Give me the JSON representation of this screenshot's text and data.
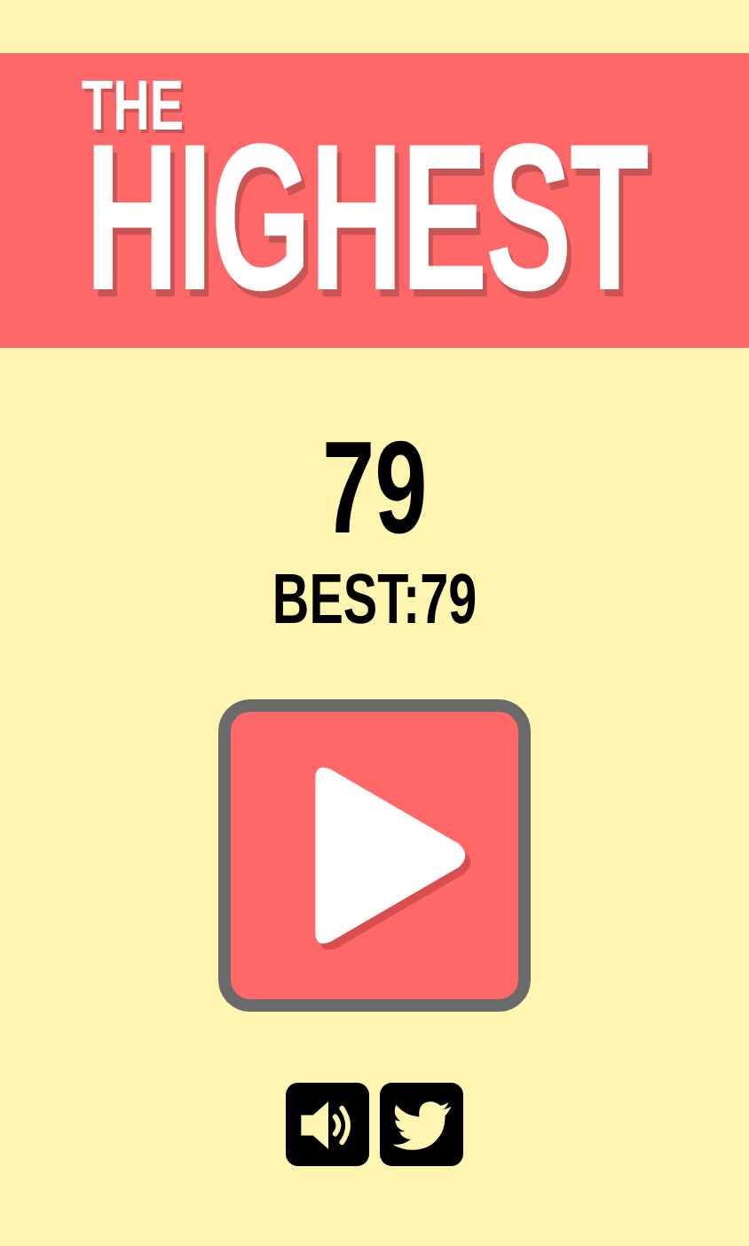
{
  "banner": {
    "pretitle": "THE",
    "title": "HIGHEST"
  },
  "score": "79",
  "best": "BEST:79"
}
